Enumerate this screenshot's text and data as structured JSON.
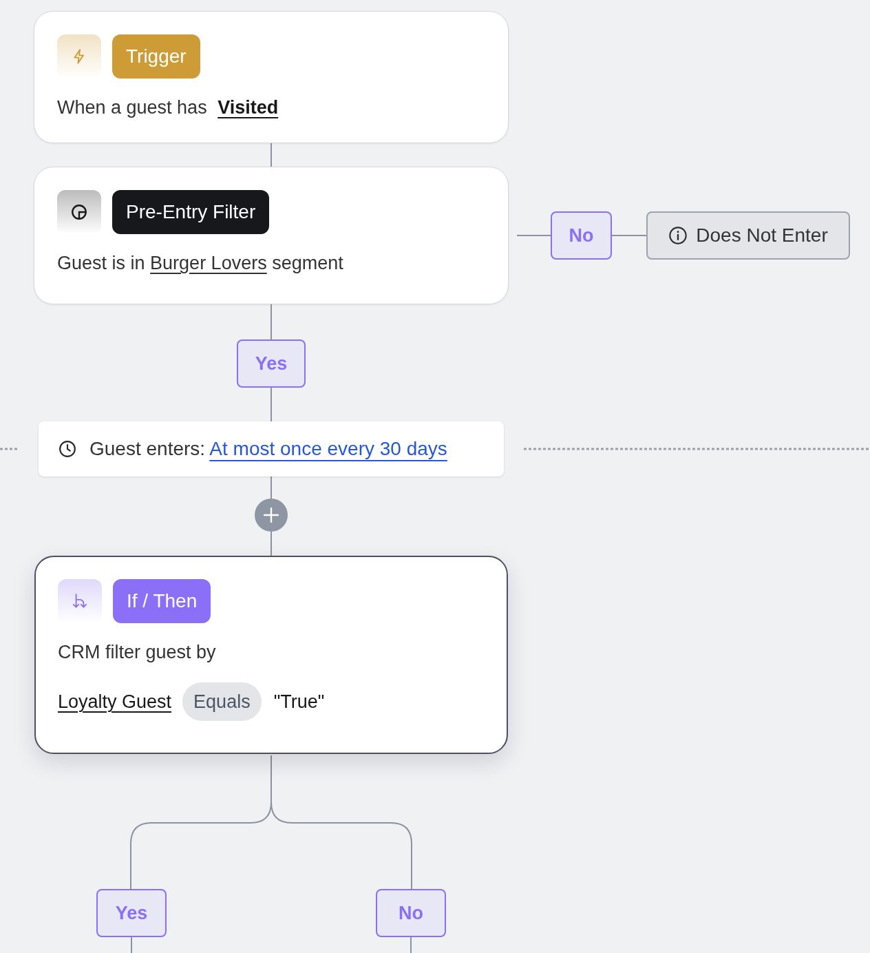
{
  "steps": [
    {
      "kind": "trigger",
      "selected": false,
      "badge": "Trigger",
      "lines": [
        {
          "kind": "sentence",
          "parts": [
            {
              "kind": "text",
              "text": "When a guest has"
            },
            {
              "kind": "link",
              "text": "Visited"
            }
          ]
        }
      ]
    },
    {
      "kind": "filter",
      "selected": false,
      "badge": "Pre-Entry Filter",
      "lines": [
        {
          "kind": "sentence",
          "parts": [
            {
              "kind": "text",
              "text": "Guest is in"
            },
            {
              "kind": "link",
              "text": "Burger Lovers"
            },
            {
              "kind": "text",
              "text": "segment"
            }
          ]
        }
      ],
      "branches": [
        {
          "label": "No",
          "outcome": "Does Not Enter"
        },
        {
          "label": "Yes"
        }
      ]
    },
    {
      "kind": "if_then",
      "selected": true,
      "badge": "If / Then",
      "lines": [
        {
          "kind": "sentence",
          "parts": [
            {
              "kind": "text",
              "text": "CRM filter guest by"
            }
          ]
        },
        {
          "kind": "condition",
          "parts": [
            {
              "kind": "link",
              "text": "Loyalty Guest"
            },
            {
              "kind": "chip",
              "text": "Equals"
            },
            {
              "kind": "text",
              "text": "\"True\""
            }
          ]
        }
      ],
      "branches": [
        {
          "label": "Yes"
        },
        {
          "label": "No"
        }
      ]
    }
  ],
  "entry_rule": {
    "label": "Guest enters:",
    "link": "At most once every 30 days"
  }
}
